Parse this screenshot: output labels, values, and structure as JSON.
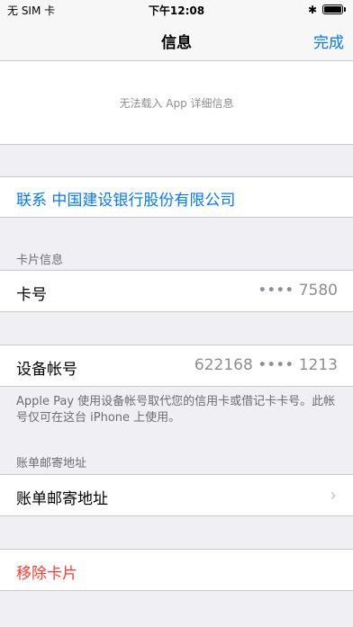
{
  "status_bar": {
    "carrier": "无 SIM 卡",
    "time": "下午12:08",
    "bluetooth_icon": "bluetooth-icon",
    "battery_icon": "battery-full-icon"
  },
  "nav": {
    "title": "信息",
    "done_label": "完成"
  },
  "app_info": {
    "message": "无法载入 App 详细信息"
  },
  "contact": {
    "label": "联系 中国建设银行股份有限公司"
  },
  "card_info": {
    "header": "卡片信息",
    "card_number_label": "卡号",
    "card_number_value": "•••• 7580"
  },
  "device": {
    "label": "设备帐号",
    "value": "622168 •••• 1213",
    "footer": "Apple Pay 使用设备帐号取代您的信用卡或借记卡卡号。此帐号仅可在这台 iPhone 上使用。"
  },
  "billing": {
    "header": "账单邮寄地址",
    "label": "账单邮寄地址",
    "chevron_icon": "chevron-right-icon"
  },
  "remove": {
    "label": "移除卡片"
  },
  "colors": {
    "accent": "#007aff",
    "destructive": "#ff3b30",
    "background": "#efeff4"
  }
}
